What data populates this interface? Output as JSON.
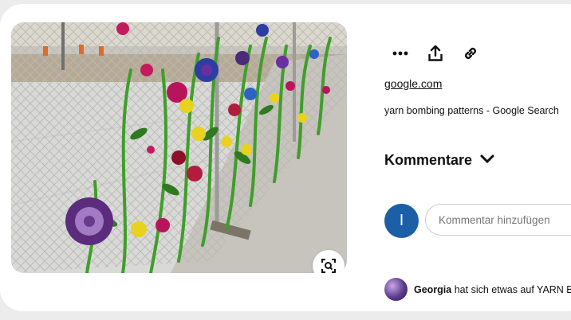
{
  "pin": {
    "image_alt": "yarn bombing fence with crocheted flowers",
    "source": "google.com",
    "title": "yarn bombing patterns - Google Search"
  },
  "actions": {
    "more_icon": "ellipsis-icon",
    "share_icon": "share-upload-icon",
    "link_icon": "link-icon",
    "lens_icon": "visual-search-icon"
  },
  "comments": {
    "title": "Kommentare",
    "avatar_initial": "I",
    "input_placeholder": "Kommentar hinzufügen",
    "input_value": ""
  },
  "activity": {
    "user": "Georgia",
    "text": "hat sich etwas auf YARN BO"
  },
  "colors": {
    "avatar_bg": "#1b5fa6",
    "card_bg": "#ffffff",
    "page_bg": "#ececec"
  }
}
